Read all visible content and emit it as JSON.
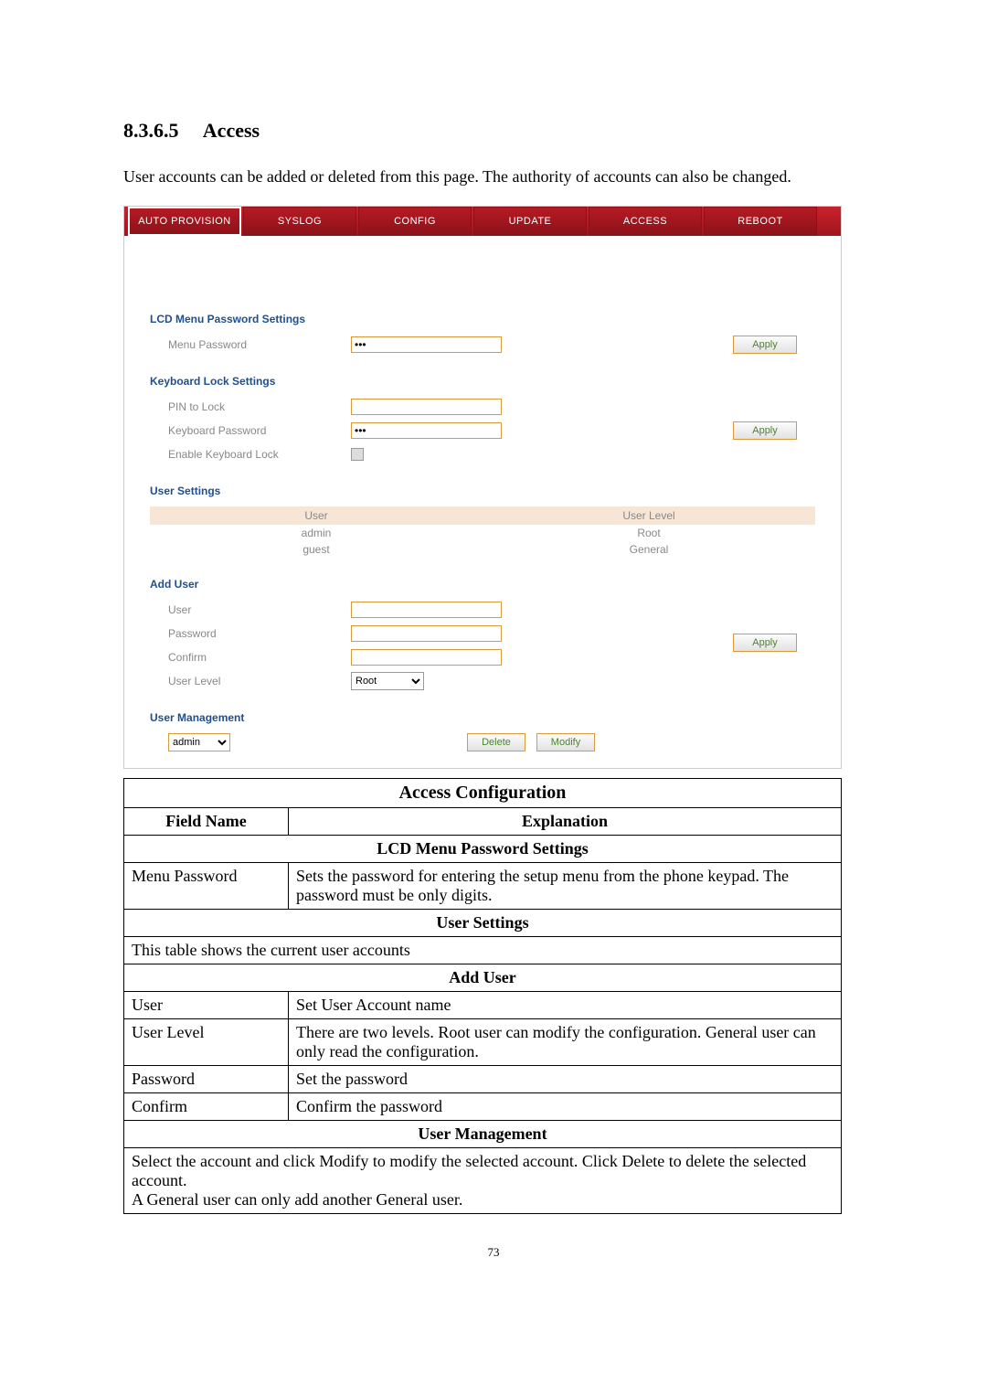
{
  "heading": {
    "num": "8.3.6.5",
    "title": "Access"
  },
  "intro": "User accounts can be added or deleted from this page.   The authority of accounts can also be changed.",
  "tabs": [
    "AUTO PROVISION",
    "SYSLOG",
    "CONFIG",
    "UPDATE",
    "ACCESS",
    "REBOOT"
  ],
  "lcd": {
    "title": "LCD Menu Password Settings",
    "menu_password_label": "Menu Password",
    "menu_password_value": "•••",
    "apply": "Apply"
  },
  "kbl": {
    "title": "Keyboard Lock Settings",
    "pin_label": "PIN to Lock",
    "pin_value": "",
    "kp_label": "Keyboard Password",
    "kp_value": "•••",
    "enable_label": "Enable Keyboard Lock",
    "apply": "Apply"
  },
  "user_settings": {
    "title": "User Settings",
    "col_user": "User",
    "col_level": "User Level",
    "rows": [
      {
        "user": "admin",
        "level": "Root"
      },
      {
        "user": "guest",
        "level": "General"
      }
    ]
  },
  "add_user": {
    "title": "Add User",
    "user_label": "User",
    "pw_label": "Password",
    "confirm_label": "Confirm",
    "level_label": "User Level",
    "level_value": "Root",
    "apply": "Apply"
  },
  "user_mgmt": {
    "title": "User Management",
    "selected": "admin",
    "delete": "Delete",
    "modify": "Modify"
  },
  "cfg": {
    "caption": "Access Configuration",
    "hdr_field": "Field Name",
    "hdr_expl": "Explanation",
    "s1": "LCD Menu Password Settings",
    "r1_field": "Menu Password",
    "r1_expl": "Sets the password for entering the setup menu from the phone keypad. The password must be only digits.",
    "s2": "User Settings",
    "r2_full": "This table shows the current user accounts",
    "s3": "Add User",
    "r3a_field": "User",
    "r3a_expl": "Set User Account name",
    "r3b_field": "User Level",
    "r3b_expl": "There are two levels.   Root user can modify the configuration. General user can only read the configuration.",
    "r3c_field": "Password",
    "r3c_expl": "Set the password",
    "r3d_field": "Confirm",
    "r3d_expl": "Confirm the password",
    "s4": "User Management",
    "r4_full_a": "Select the account and click Modify to modify the selected account.   Click Delete to delete the selected account.",
    "r4_full_b": "A General user can only add another General user."
  },
  "page_num": "73"
}
